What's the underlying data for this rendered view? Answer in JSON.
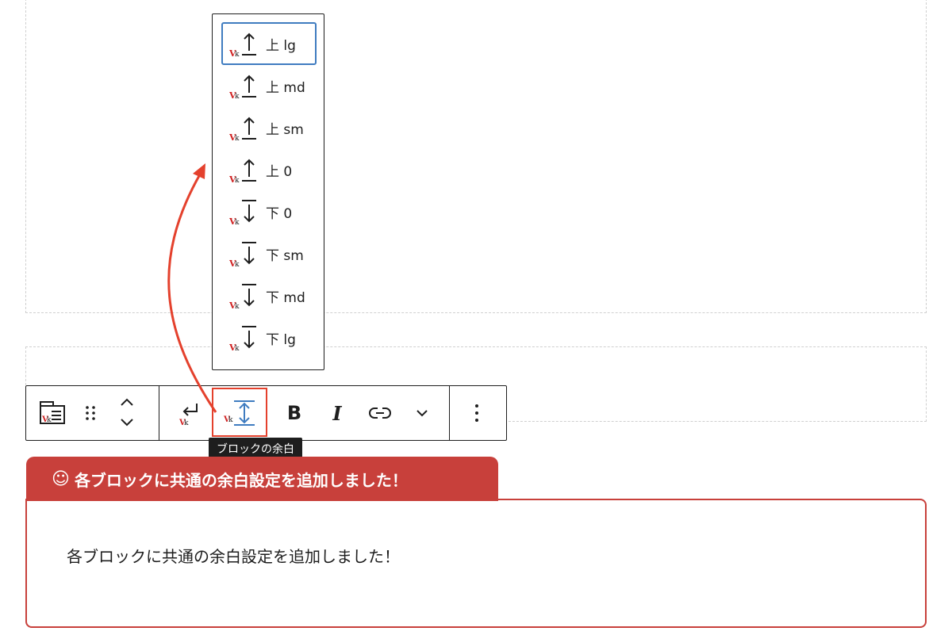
{
  "spacing_menu": {
    "items": [
      {
        "label": "上 lg",
        "direction": "up",
        "active": true
      },
      {
        "label": "上 md",
        "direction": "up",
        "active": false
      },
      {
        "label": "上 sm",
        "direction": "up",
        "active": false
      },
      {
        "label": "上 0",
        "direction": "up",
        "active": false
      },
      {
        "label": "下 0",
        "direction": "down",
        "active": false
      },
      {
        "label": "下 sm",
        "direction": "down",
        "active": false
      },
      {
        "label": "下 md",
        "direction": "down",
        "active": false
      },
      {
        "label": "下 lg",
        "direction": "down",
        "active": false
      }
    ]
  },
  "toolbar": {
    "buttons": [
      {
        "name": "block-type-button",
        "icon": "vk-block-icon"
      },
      {
        "name": "drag-handle",
        "icon": "drag-dots-icon"
      },
      {
        "name": "move-up-down-button",
        "icon": "chevron-up-down-icon"
      },
      {
        "name": "line-break-button",
        "icon": "enter-arrow-icon"
      },
      {
        "name": "block-margin-button",
        "icon": "vertical-spacing-icon"
      },
      {
        "name": "bold-button",
        "label": "B"
      },
      {
        "name": "italic-button",
        "label": "I"
      },
      {
        "name": "link-button",
        "icon": "link-icon"
      },
      {
        "name": "more-format-button",
        "icon": "chevron-down-icon"
      },
      {
        "name": "options-button",
        "icon": "vertical-ellipsis-icon"
      }
    ]
  },
  "tooltip": {
    "text": "ブロックの余白"
  },
  "notice": {
    "tab_icon": "☺",
    "title": "各ブロックに共通の余白設定を追加しました！",
    "body": "各ブロックに共通の余白設定を追加しました！"
  },
  "colors": {
    "accent_red": "#c8403b",
    "highlight_red": "#e4412d",
    "focus_blue": "#3f7cc0",
    "text": "#1e1e1e"
  }
}
